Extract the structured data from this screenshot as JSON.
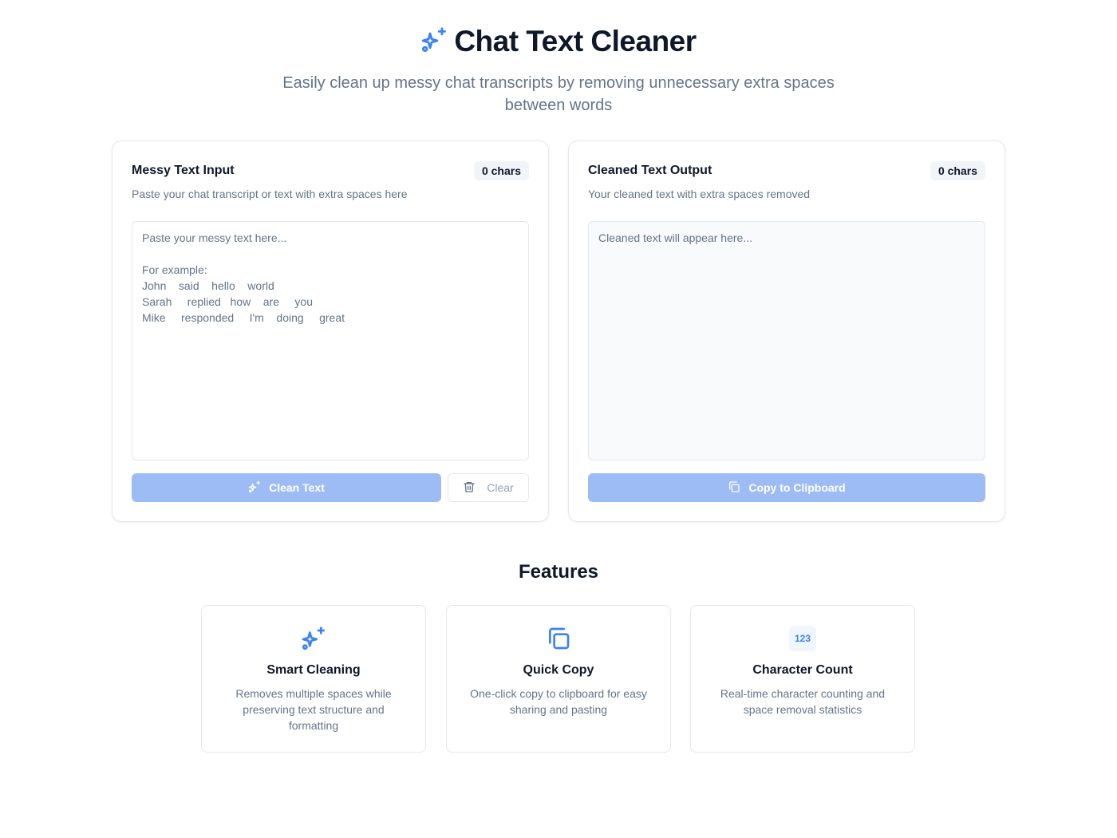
{
  "header": {
    "title": "Chat Text Cleaner",
    "icon": "sparkles-icon",
    "subtitle": "Easily clean up messy chat transcripts by removing unnecessary extra spaces between words"
  },
  "input_panel": {
    "title": "Messy Text Input",
    "char_count": "0 chars",
    "description": "Paste your chat transcript or text with extra spaces here",
    "placeholder": "Paste your messy text here...\n\nFor example:\nJohn    said    hello    world\nSarah     replied   how    are     you\nMike     responded     I'm    doing     great",
    "clean_button": "Clean Text",
    "clean_icon": "sparkles-icon",
    "clear_button": "Clear",
    "clear_icon": "trash-icon"
  },
  "output_panel": {
    "title": "Cleaned Text Output",
    "char_count": "0 chars",
    "description": "Your cleaned text with extra spaces removed",
    "placeholder": "Cleaned text will appear here...",
    "copy_button": "Copy to Clipboard",
    "copy_icon": "copy-icon"
  },
  "features": {
    "title": "Features",
    "items": [
      {
        "icon": "sparkles-icon",
        "name": "Smart Cleaning",
        "description": "Removes multiple spaces while preserving text structure and formatting"
      },
      {
        "icon": "copy-icon",
        "name": "Quick Copy",
        "description": "One-click copy to clipboard for easy sharing and pasting"
      },
      {
        "icon": "123",
        "name": "Character Count",
        "description": "Real-time character counting and space removal statistics"
      }
    ]
  },
  "colors": {
    "accent": "#3b82f6",
    "button_disabled": "#9dbcf5",
    "text_primary": "#0f172a",
    "text_muted": "#64748b",
    "border": "#e2e8f0"
  }
}
